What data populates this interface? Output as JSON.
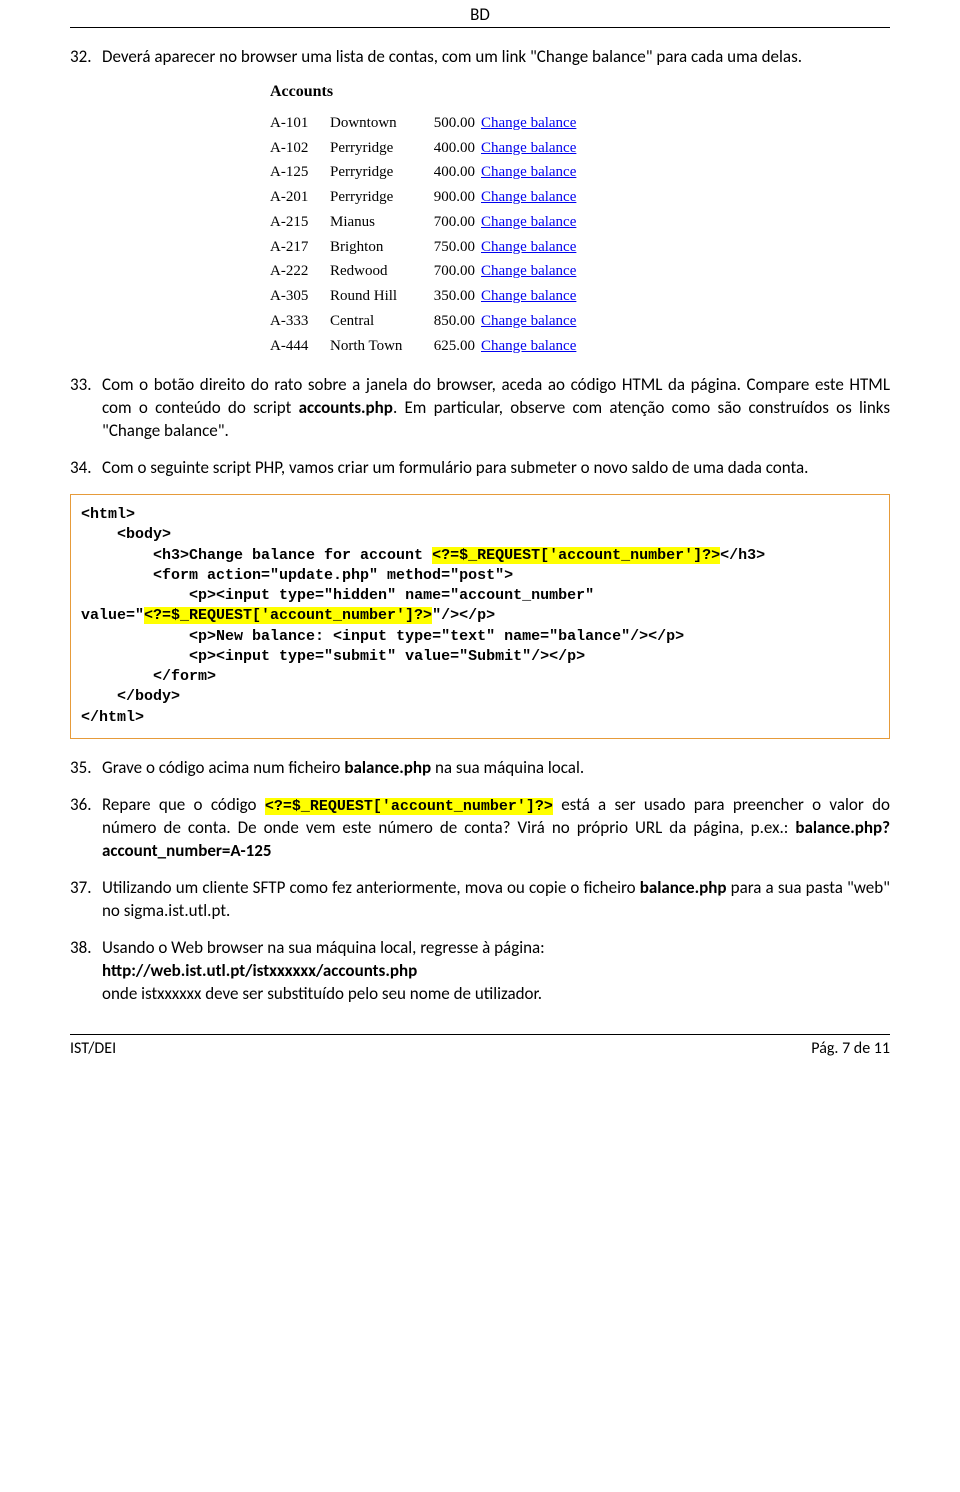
{
  "header": {
    "title": "BD"
  },
  "steps": {
    "s32": {
      "num": "32.",
      "text": "Deverá aparecer no browser uma lista de contas, com um link \"Change balance\" para cada uma delas."
    },
    "s33": {
      "num": "33.",
      "text_a": "Com o botão direito do rato sobre a janela do browser, aceda ao código HTML da página. Compare este HTML com o conteúdo do script ",
      "bold": "accounts.php",
      "text_b": ". Em particular, observe com atenção como são construídos os links \"Change balance\"."
    },
    "s34": {
      "num": "34.",
      "text": "Com o seguinte script PHP, vamos criar um formulário para submeter o novo saldo de uma dada conta."
    },
    "s35": {
      "num": "35.",
      "text_a": "Grave o código acima num ficheiro ",
      "bold": "balance.php",
      "text_b": " na sua máquina local."
    },
    "s36": {
      "num": "36.",
      "text_a": "Repare que o código ",
      "code": "<?=$_REQUEST['account_number']?>",
      "text_b": " está a ser usado para preencher o valor do número de conta. De onde vem este número de conta? Virá no próprio URL da página, p.ex.: ",
      "bold": "balance.php?account_number=A-125"
    },
    "s37": {
      "num": "37.",
      "text_a": "Utilizando um cliente SFTP como fez anteriormente, mova ou copie o ficheiro ",
      "bold": "balance.php",
      "text_b": " para a sua pasta \"web\" no sigma.ist.utl.pt."
    },
    "s38": {
      "num": "38.",
      "line1": "Usando o Web browser na sua máquina local, regresse à página:",
      "line2": "http://web.ist.utl.pt/istxxxxxx/accounts.php",
      "line3": "onde istxxxxxx deve ser substituído pelo seu nome de utilizador."
    }
  },
  "accounts": {
    "title": "Accounts",
    "link_label": "Change balance",
    "rows": [
      {
        "id": "A-101",
        "branch": "Downtown",
        "bal": "500.00"
      },
      {
        "id": "A-102",
        "branch": "Perryridge",
        "bal": "400.00"
      },
      {
        "id": "A-125",
        "branch": "Perryridge",
        "bal": "400.00"
      },
      {
        "id": "A-201",
        "branch": "Perryridge",
        "bal": "900.00"
      },
      {
        "id": "A-215",
        "branch": "Mianus",
        "bal": "700.00"
      },
      {
        "id": "A-217",
        "branch": "Brighton",
        "bal": "750.00"
      },
      {
        "id": "A-222",
        "branch": "Redwood",
        "bal": "700.00"
      },
      {
        "id": "A-305",
        "branch": "Round Hill",
        "bal": "350.00"
      },
      {
        "id": "A-333",
        "branch": "Central",
        "bal": "850.00"
      },
      {
        "id": "A-444",
        "branch": "North Town",
        "bal": "625.00"
      }
    ]
  },
  "code": {
    "l1": "<html>",
    "l2": "    <body>",
    "l3a": "        <h3>Change balance for account ",
    "l3h": "<?=$_REQUEST['account_number']?>",
    "l3b": "</h3>",
    "l4": "        <form action=\"update.php\" method=\"post\">",
    "l5": "            <p><input type=\"hidden\" name=\"account_number\"",
    "l6a": "value=\"",
    "l6h": "<?=$_REQUEST['account_number']?>",
    "l6b": "\"/></p>",
    "l7": "            <p>New balance: <input type=\"text\" name=\"balance\"/></p>",
    "l8": "            <p><input type=\"submit\" value=\"Submit\"/></p>",
    "l9": "        </form>",
    "l10": "    </body>",
    "l11": "</html>"
  },
  "footer": {
    "left": "IST/DEI",
    "right": "Pág. 7 de 11"
  }
}
